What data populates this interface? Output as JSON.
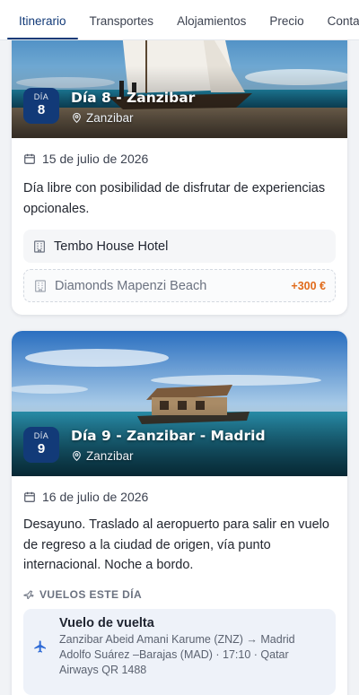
{
  "tabs": [
    {
      "label": "Itinerario",
      "active": true
    },
    {
      "label": "Transportes"
    },
    {
      "label": "Alojamientos"
    },
    {
      "label": "Precio"
    },
    {
      "label": "Contacto"
    }
  ],
  "days": [
    {
      "day_label": "DÍA",
      "day_number": "8",
      "title": "Día 8 - Zanzibar",
      "location": "Zanzibar",
      "date": "15 de julio de 2026",
      "description": "Día libre con posibilidad de disfrutar de experiencias opcionales.",
      "hotels": [
        {
          "name": "Tembo House Hotel"
        },
        {
          "name": "Diamonds Mapenzi Beach",
          "price": "+300 €"
        }
      ]
    },
    {
      "day_label": "DÍA",
      "day_number": "9",
      "title": "Día 9 - Zanzibar - Madrid",
      "location": "Zanzibar",
      "date": "16 de julio de 2026",
      "description": "Desayuno. Traslado al aeropuerto para salir en vuelo de regreso a la ciudad de origen, vía punto internacional. Noche a bordo.",
      "flights_heading": "VUELOS ESTE DÍA",
      "flight": {
        "title": "Vuelo de vuelta",
        "details": "Zanzibar Abeid Amani Karume (ZNZ) → Madrid Adolfo Suárez –Barajas (MAD) · 17:10 · Qatar Airways QR 1488"
      }
    }
  ],
  "colors": {
    "accent": "#123a78",
    "price": "#e06b1b"
  }
}
